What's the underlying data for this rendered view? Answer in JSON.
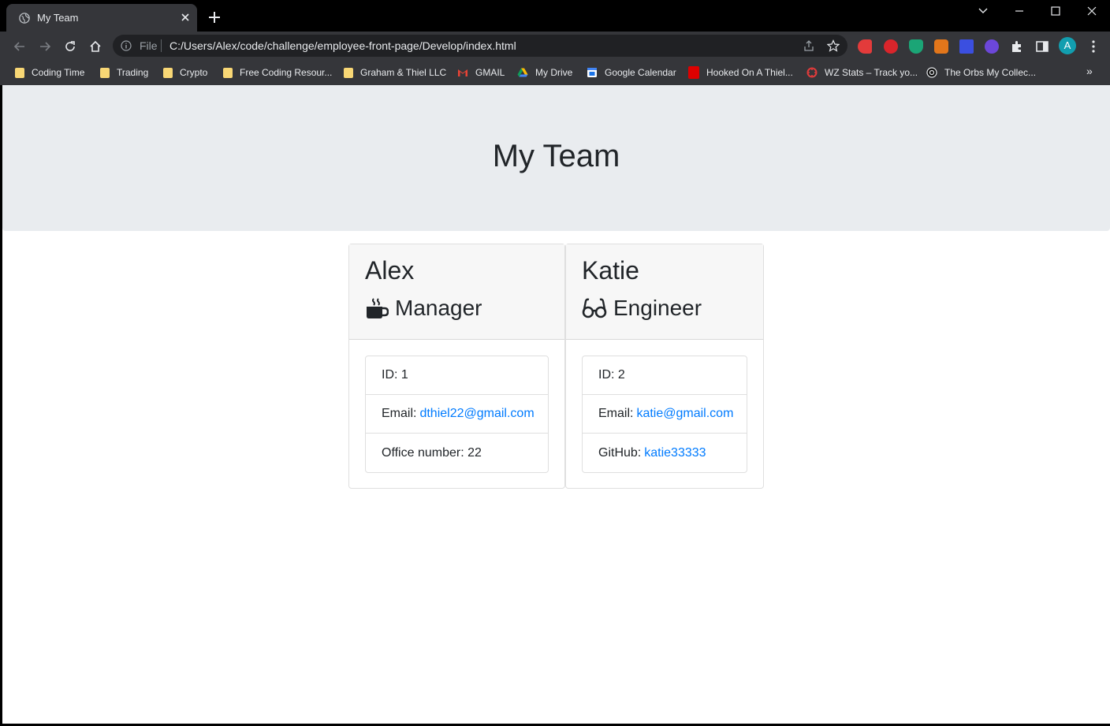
{
  "browser": {
    "tab_title": "My Team",
    "file_label": "File",
    "url": "C:/Users/Alex/code/challenge/employee-front-page/Develop/index.html",
    "profile_initial": "A",
    "bookmarks": [
      {
        "label": "Coding Time",
        "icon": "folder-icon"
      },
      {
        "label": "Trading",
        "icon": "folder-icon"
      },
      {
        "label": "Crypto",
        "icon": "folder-icon"
      },
      {
        "label": "Free Coding Resour...",
        "icon": "folder-icon"
      },
      {
        "label": "Graham & Thiel LLC",
        "icon": "folder-icon"
      },
      {
        "label": "GMAIL",
        "icon": "gmail-icon"
      },
      {
        "label": "My Drive",
        "icon": "google-drive-icon"
      },
      {
        "label": "Google Calendar",
        "icon": "google-calendar-icon"
      },
      {
        "label": "Hooked On A Thiel...",
        "icon": "espn-icon"
      },
      {
        "label": "WZ Stats – Track yo...",
        "icon": "wz-stats-icon"
      },
      {
        "label": "The Orbs My Collec...",
        "icon": "orb-icon"
      }
    ],
    "more_bookmarks": "»",
    "colors": {
      "tab_bg": "#35363a",
      "titlebar_bg": "#000000",
      "profile": "#129eaf"
    }
  },
  "page": {
    "header_title": "My Team",
    "colors": {
      "jumbotron": "#e9ecef",
      "link": "#007bff",
      "text": "#212529"
    },
    "employees": [
      {
        "name": "Alex",
        "role": "Manager",
        "role_icon": "mug-icon",
        "id_text": "ID: 1",
        "email_label": "Email:",
        "email": "dthiel22@gmail.com",
        "extra_text": "Office number: 22"
      },
      {
        "name": "Katie",
        "role": "Engineer",
        "role_icon": "glasses-icon",
        "id_text": "ID: 2",
        "email_label": "Email:",
        "email": "katie@gmail.com",
        "extra_label": "GitHub:",
        "extra_link": "katie33333"
      }
    ]
  }
}
